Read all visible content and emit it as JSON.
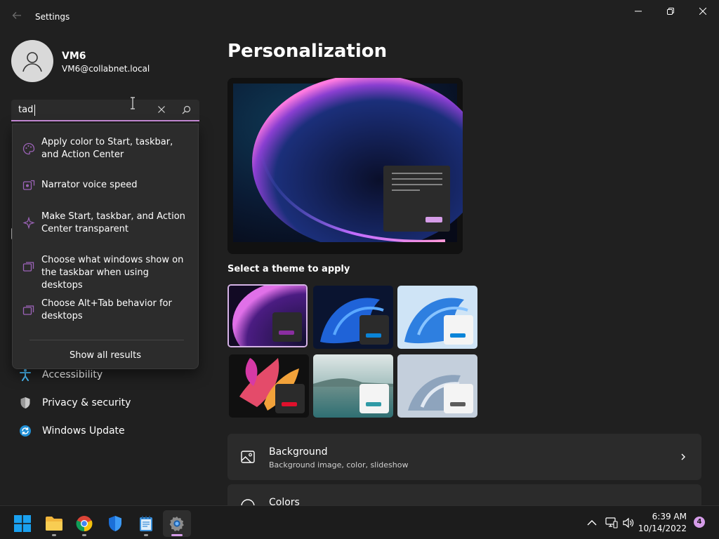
{
  "window": {
    "title": "Settings"
  },
  "profile": {
    "name": "VM6",
    "email": "VM6@collabnet.local"
  },
  "search": {
    "value": "tad"
  },
  "suggestions": [
    {
      "text": "Apply color to Start, taskbar, and Action Center",
      "icon": "palette-icon"
    },
    {
      "text": "Narrator voice speed",
      "icon": "narrator-icon"
    },
    {
      "text": "Make Start, taskbar, and Action Center transparent",
      "icon": "sparkle-icon"
    },
    {
      "text": "Choose what windows show on the taskbar when using desktops",
      "icon": "multitask-icon"
    },
    {
      "text": "Choose Alt+Tab behavior for desktops",
      "icon": "multitask-icon"
    }
  ],
  "show_all": "Show all results",
  "nav": [
    {
      "label": "Accessibility",
      "icon": "accessibility-icon"
    },
    {
      "label": "Privacy & security",
      "icon": "shield-icon"
    },
    {
      "label": "Windows Update",
      "icon": "update-icon"
    }
  ],
  "main": {
    "title": "Personalization",
    "theme_heading": "Select a theme to apply",
    "cards": [
      {
        "title": "Background",
        "subtitle": "Background image, color, slideshow",
        "icon": "image-icon"
      },
      {
        "title": "Colors",
        "icon": "palette-icon"
      }
    ]
  },
  "taskbar": {
    "time": "6:39 AM",
    "date": "10/14/2022",
    "notifications": "4"
  },
  "colors": {
    "accent": "#c88bd8",
    "background": "#202020",
    "card": "#2b2b2b"
  }
}
